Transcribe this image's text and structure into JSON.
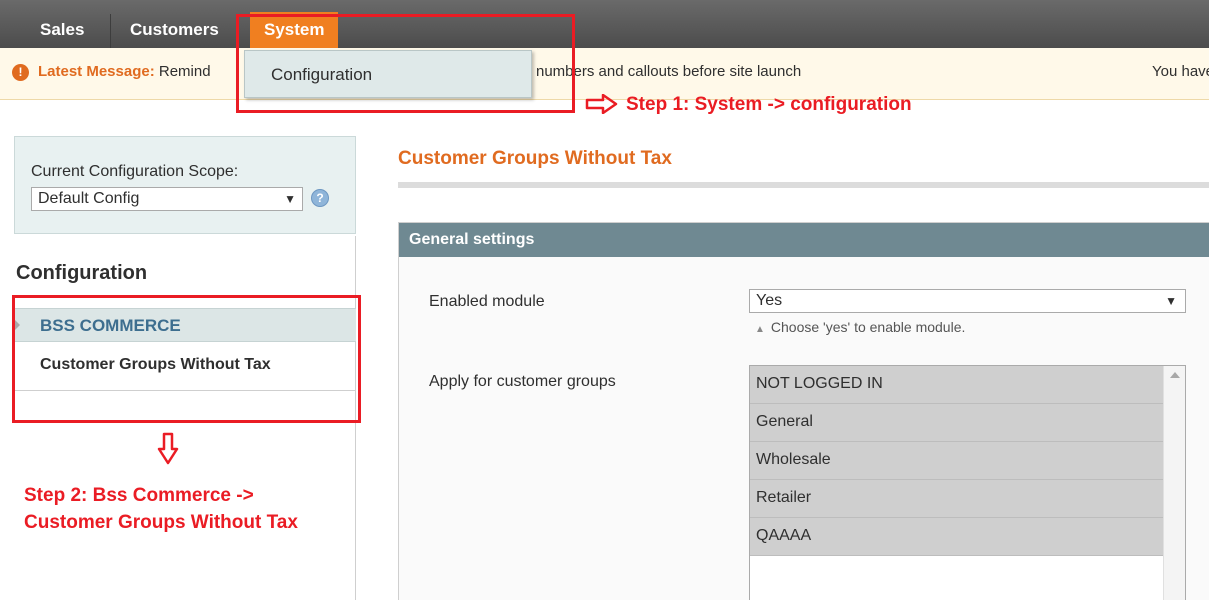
{
  "nav": {
    "items": [
      "Sales",
      "Customers",
      "System"
    ]
  },
  "message": {
    "lead_label": "Latest Message:",
    "lead_text": " Remind",
    "rest_text": "numbers and callouts before site launch",
    "right_text": "You have"
  },
  "dropdown": {
    "option": "Configuration"
  },
  "annotations": {
    "step1": "Step 1: System -> configuration",
    "step2_line1": "Step 2: Bss Commerce ->",
    "step2_line2": "Customer Groups Without Tax"
  },
  "scope": {
    "label": "Current Configuration Scope:",
    "value": "Default Config",
    "help": "?"
  },
  "sidebar": {
    "title": "Configuration",
    "group": "BSS COMMERCE",
    "item": "Customer Groups Without Tax"
  },
  "main": {
    "title": "Customer Groups Without Tax",
    "section": "General settings",
    "enabled_label": "Enabled module",
    "enabled_value": "Yes",
    "enabled_note": "Choose 'yes' to enable module.",
    "groups_label": "Apply for customer groups",
    "groups": [
      "NOT LOGGED IN",
      "General",
      "Wholesale",
      "Retailer",
      "QAAAA"
    ]
  },
  "colors": {
    "accent": "#e06b20",
    "annotation": "#ea1c24",
    "section_header": "#6f8992"
  }
}
